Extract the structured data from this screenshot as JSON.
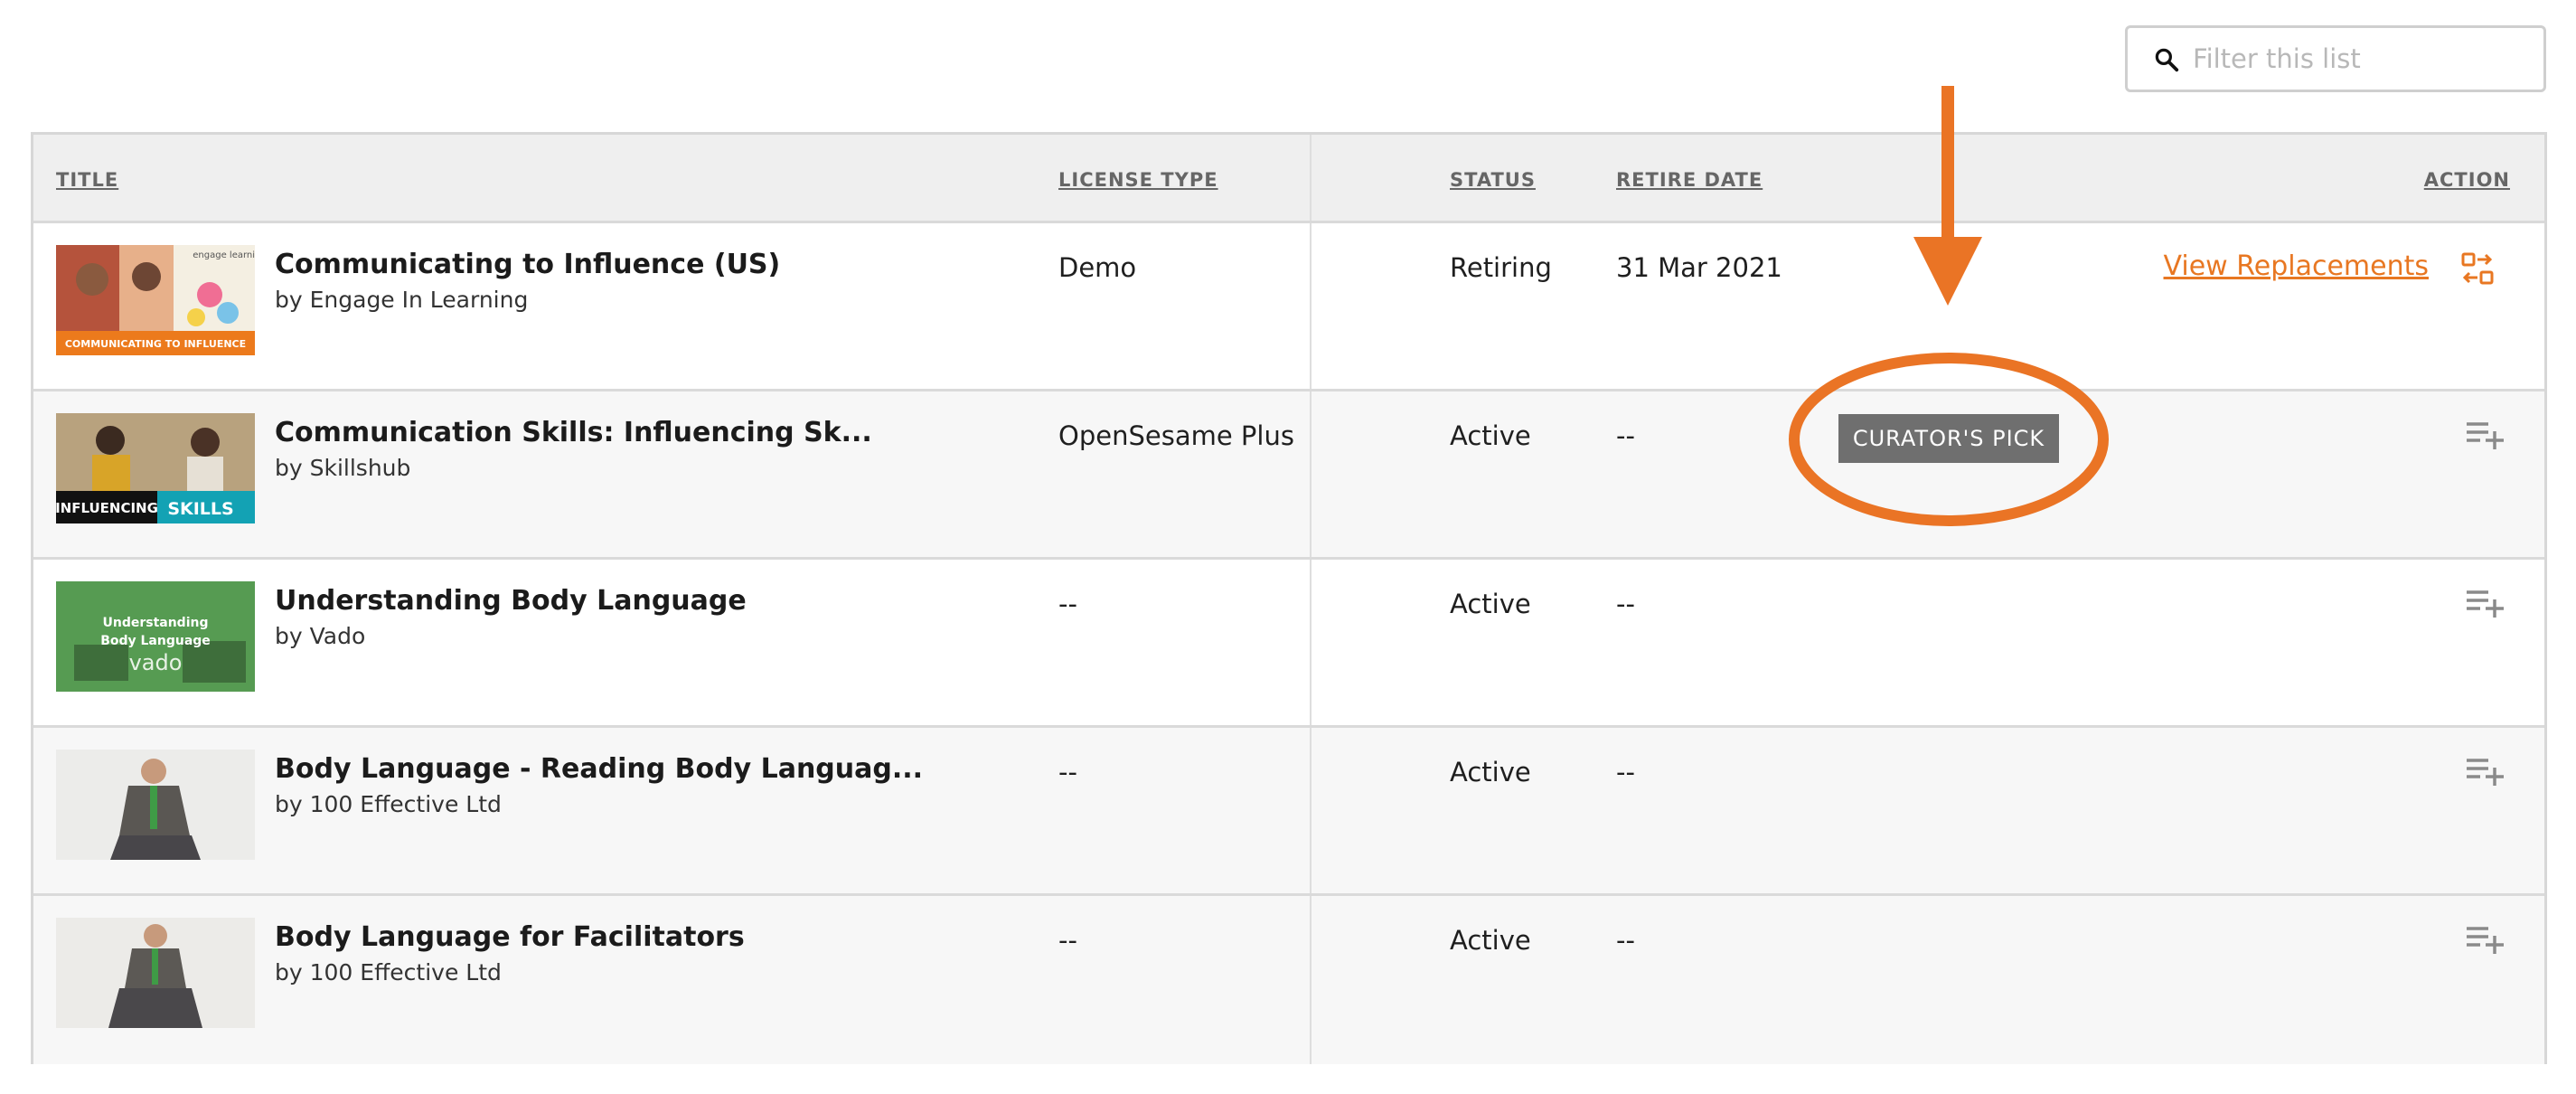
{
  "search": {
    "placeholder": "Filter this list"
  },
  "columns": {
    "title": "TITLE",
    "license_type": "LICENSE TYPE",
    "status": "STATUS",
    "retire_date": "RETIRE DATE",
    "action": "ACTION"
  },
  "rows": [
    {
      "title": "Communicating to Influence (US)",
      "author": "by Engage In Learning",
      "license_type": "Demo",
      "status": "Retiring",
      "retire_date": "31 Mar 2021",
      "action_label": "View Replacements",
      "thumb_caption": "COMMUNICATING TO INFLUENCE",
      "thumb_logo": "engage learning"
    },
    {
      "title": "Communication Skills: Influencing Sk...",
      "author": "by Skillshub",
      "license_type": "OpenSesame Plus",
      "status": "Active",
      "retire_date": "--",
      "badge": "CURATOR'S PICK",
      "thumb_caption_a": "INFLUENCING",
      "thumb_caption_b": "SKILLS"
    },
    {
      "title": "Understanding Body Language",
      "author": "by Vado",
      "license_type": "--",
      "status": "Active",
      "retire_date": "--",
      "thumb_caption_a": "Understanding",
      "thumb_caption_b": "Body Language",
      "thumb_logo": "vado"
    },
    {
      "title": "Body Language - Reading Body Languag...",
      "author": "by 100 Effective Ltd",
      "license_type": "--",
      "status": "Active",
      "retire_date": "--"
    },
    {
      "title": "Body Language for Facilitators",
      "author": "by 100 Effective Ltd",
      "license_type": "--",
      "status": "Active",
      "retire_date": "--"
    }
  ],
  "colors": {
    "accent": "#e87722",
    "badge_bg": "#6f6f6f",
    "header_bg": "#efefef",
    "row_shaded": "#f7f7f7"
  },
  "icons": {
    "search": "search-icon",
    "replace": "swap-icon",
    "add_to_playlist": "playlist-add-icon",
    "annotation_arrow": "arrow-down-icon"
  }
}
